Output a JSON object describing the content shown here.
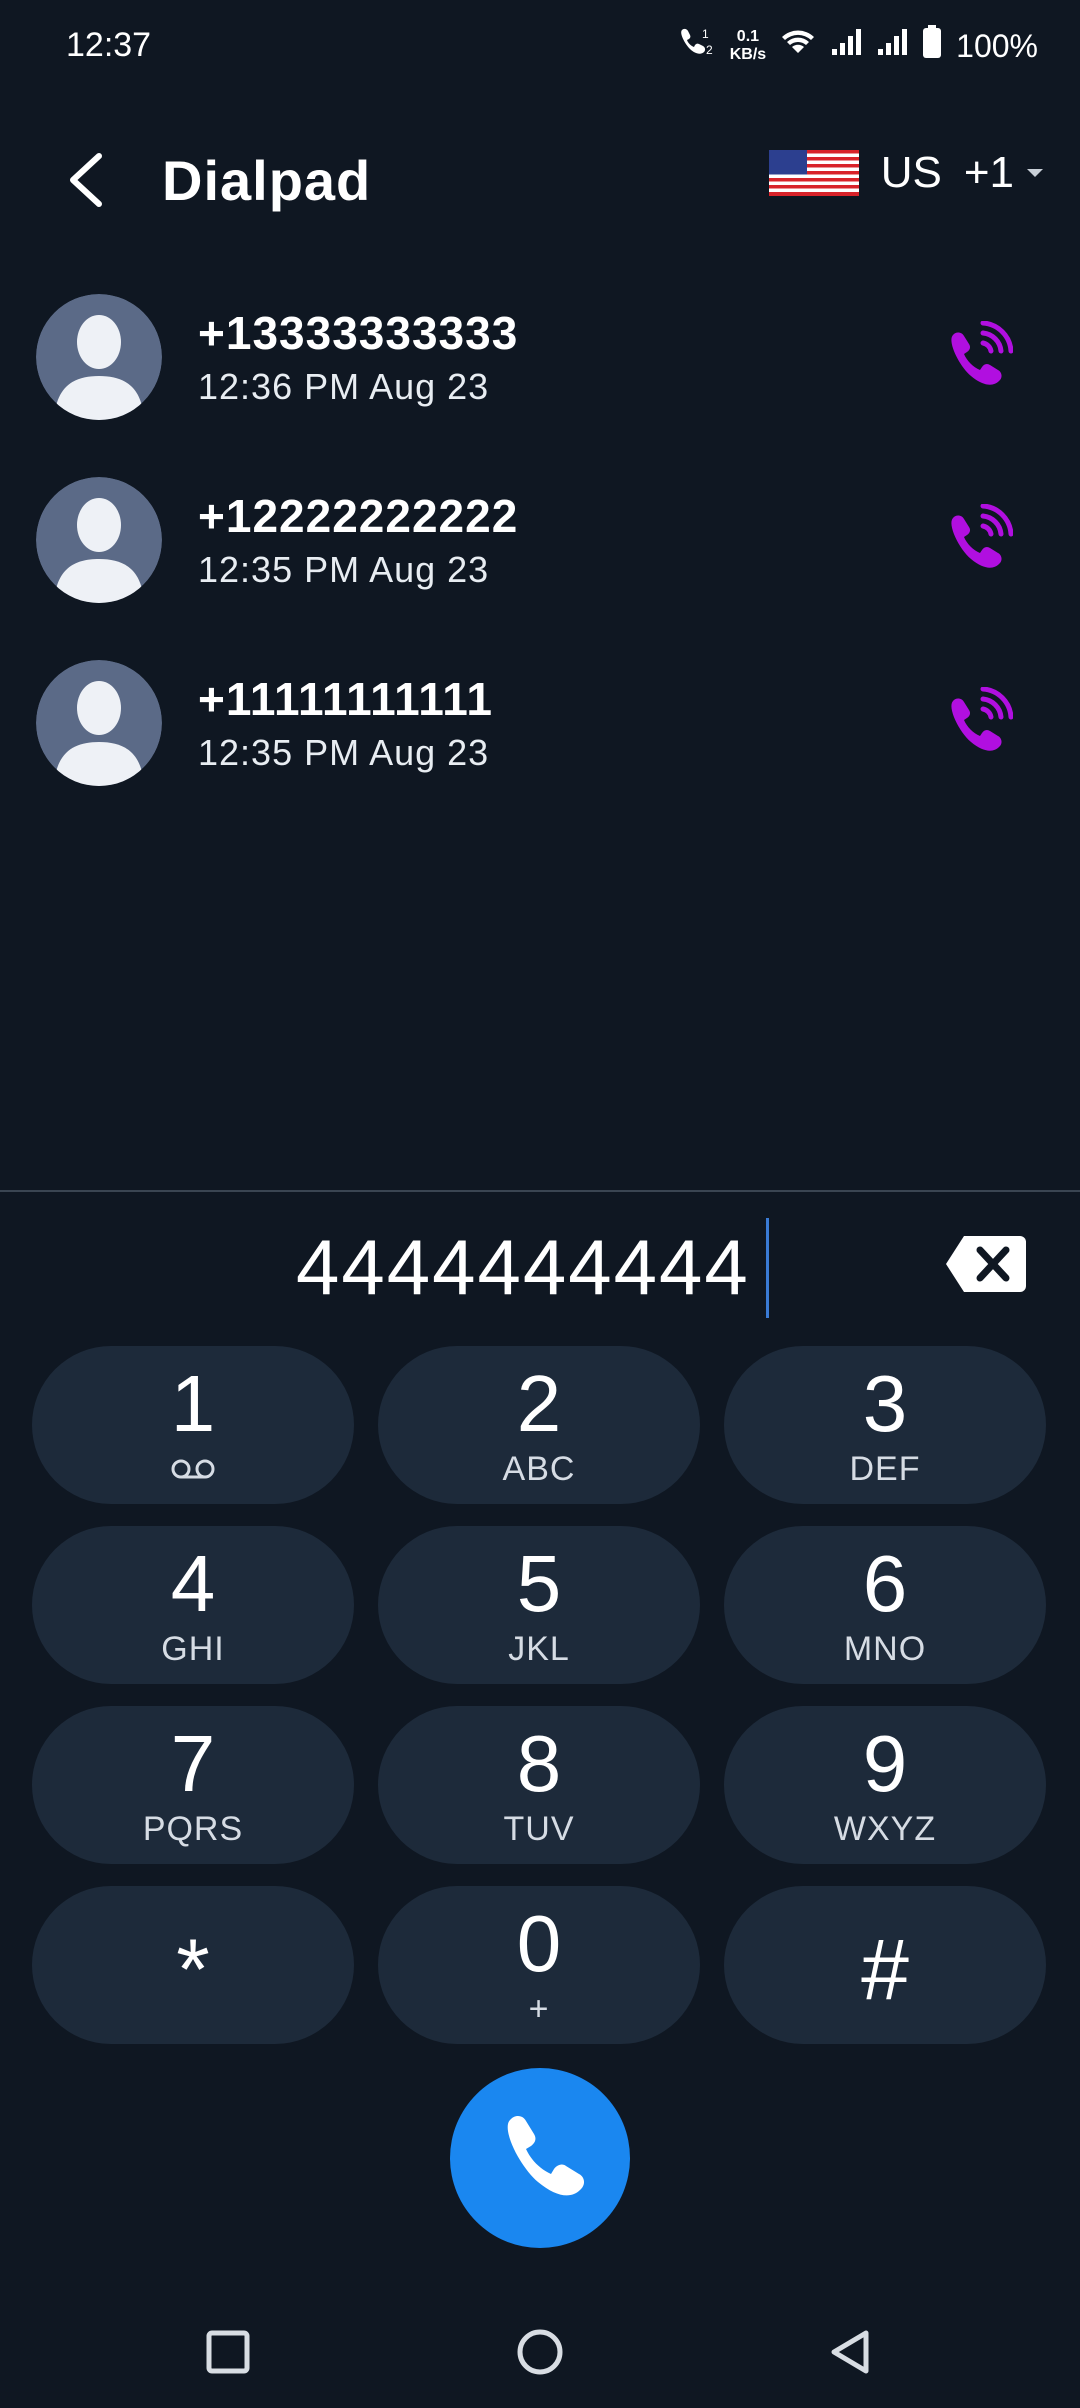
{
  "status_bar": {
    "time": "12:37",
    "net_speed_value": "0.1",
    "net_speed_unit": "KB/s",
    "battery": "100%"
  },
  "header": {
    "title": "Dialpad",
    "country_code": "US",
    "dial_prefix": "+1"
  },
  "recent_calls": [
    {
      "number": "+13333333333",
      "time": "12:36 PM Aug 23"
    },
    {
      "number": "+12222222222",
      "time": "12:35 PM Aug 23"
    },
    {
      "number": "+11111111111",
      "time": "12:35 PM Aug 23"
    }
  ],
  "input": {
    "value": "4444444444"
  },
  "keypad": [
    {
      "digit": "1",
      "letters": ""
    },
    {
      "digit": "2",
      "letters": "ABC"
    },
    {
      "digit": "3",
      "letters": "DEF"
    },
    {
      "digit": "4",
      "letters": "GHI"
    },
    {
      "digit": "5",
      "letters": "JKL"
    },
    {
      "digit": "6",
      "letters": "MNO"
    },
    {
      "digit": "7",
      "letters": "PQRS"
    },
    {
      "digit": "8",
      "letters": "TUV"
    },
    {
      "digit": "9",
      "letters": "WXYZ"
    },
    {
      "digit": "*",
      "letters": ""
    },
    {
      "digit": "0",
      "letters": "+"
    },
    {
      "digit": "#",
      "letters": ""
    }
  ],
  "colors": {
    "background": "#0f1722",
    "key_bg": "#1d2a3a",
    "accent_call": "#1a87f0",
    "recent_call_icon": "#b10fe0"
  },
  "icons": {
    "back": "back-arrow-icon",
    "flag": "us-flag-icon",
    "dropdown": "dropdown-caret-icon",
    "avatar": "person-silhouette-icon",
    "call_action": "phone-calling-icon",
    "backspace": "backspace-icon",
    "voicemail": "voicemail-icon",
    "call": "phone-icon",
    "nav_recents": "square-icon",
    "nav_home": "circle-icon",
    "nav_back": "triangle-back-icon"
  }
}
